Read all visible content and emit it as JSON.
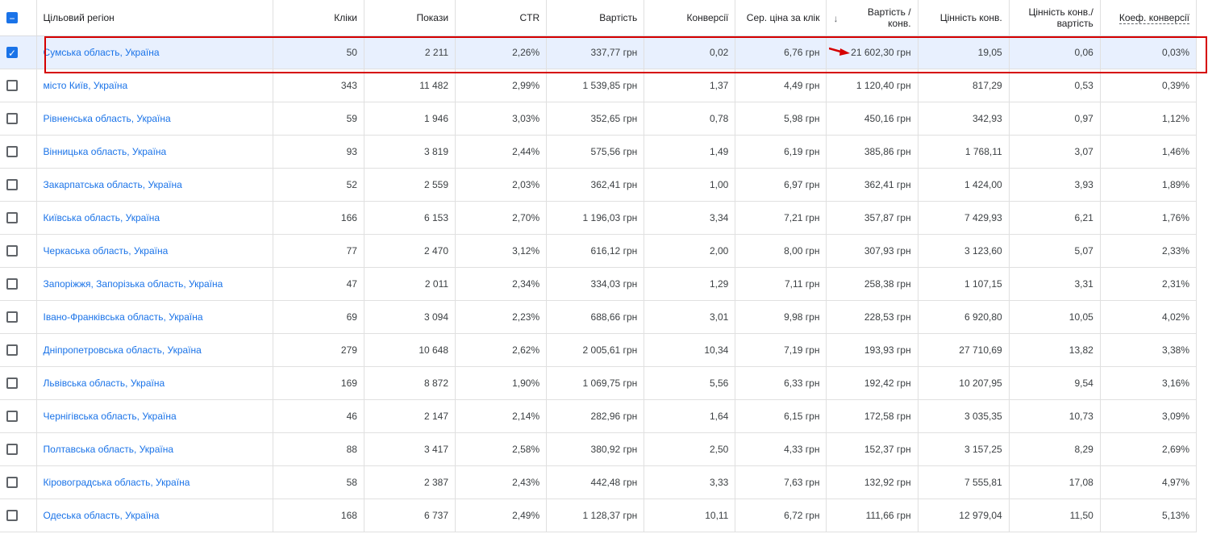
{
  "headers": {
    "region": "Цільовий регіон",
    "clicks": "Кліки",
    "impr": "Покази",
    "ctr": "CTR",
    "cost": "Вартість",
    "conv": "Конверсії",
    "cpc": "Сер. ціна за клік",
    "cpa1": "Вартість /",
    "cpa2": "конв.",
    "value": "Цінність конв.",
    "vpc1": "Цінність конв./",
    "vpc2": "вартість",
    "rate": "Коеф. конверсії"
  },
  "highlight_color": "#d50000",
  "rows": [
    [
      "Сумська область, Україна",
      "50",
      "2 211",
      "2,26%",
      "337,77 грн",
      "0,02",
      "6,76 грн",
      "21 602,30 грн",
      "19,05",
      "0,06",
      "0,03%"
    ],
    [
      "місто Київ, Україна",
      "343",
      "11 482",
      "2,99%",
      "1 539,85 грн",
      "1,37",
      "4,49 грн",
      "1 120,40 грн",
      "817,29",
      "0,53",
      "0,39%"
    ],
    [
      "Рівненська область, Україна",
      "59",
      "1 946",
      "3,03%",
      "352,65 грн",
      "0,78",
      "5,98 грн",
      "450,16 грн",
      "342,93",
      "0,97",
      "1,12%"
    ],
    [
      "Вінницька область, Україна",
      "93",
      "3 819",
      "2,44%",
      "575,56 грн",
      "1,49",
      "6,19 грн",
      "385,86 грн",
      "1 768,11",
      "3,07",
      "1,46%"
    ],
    [
      "Закарпатська область, Україна",
      "52",
      "2 559",
      "2,03%",
      "362,41 грн",
      "1,00",
      "6,97 грн",
      "362,41 грн",
      "1 424,00",
      "3,93",
      "1,89%"
    ],
    [
      "Київська область, Україна",
      "166",
      "6 153",
      "2,70%",
      "1 196,03 грн",
      "3,34",
      "7,21 грн",
      "357,87 грн",
      "7 429,93",
      "6,21",
      "1,76%"
    ],
    [
      "Черкаська область, Україна",
      "77",
      "2 470",
      "3,12%",
      "616,12 грн",
      "2,00",
      "8,00 грн",
      "307,93 грн",
      "3 123,60",
      "5,07",
      "2,33%"
    ],
    [
      "Запоріжжя, Запорізька область, Україна",
      "47",
      "2 011",
      "2,34%",
      "334,03 грн",
      "1,29",
      "7,11 грн",
      "258,38 грн",
      "1 107,15",
      "3,31",
      "2,31%"
    ],
    [
      "Івано-Франківська область, Україна",
      "69",
      "3 094",
      "2,23%",
      "688,66 грн",
      "3,01",
      "9,98 грн",
      "228,53 грн",
      "6 920,80",
      "10,05",
      "4,02%"
    ],
    [
      "Дніпропетровська область, Україна",
      "279",
      "10 648",
      "2,62%",
      "2 005,61 грн",
      "10,34",
      "7,19 грн",
      "193,93 грн",
      "27 710,69",
      "13,82",
      "3,38%"
    ],
    [
      "Львівська область, Україна",
      "169",
      "8 872",
      "1,90%",
      "1 069,75 грн",
      "5,56",
      "6,33 грн",
      "192,42 грн",
      "10 207,95",
      "9,54",
      "3,16%"
    ],
    [
      "Чернігівська область, Україна",
      "46",
      "2 147",
      "2,14%",
      "282,96 грн",
      "1,64",
      "6,15 грн",
      "172,58 грн",
      "3 035,35",
      "10,73",
      "3,09%"
    ],
    [
      "Полтавська область, Україна",
      "88",
      "3 417",
      "2,58%",
      "380,92 грн",
      "2,50",
      "4,33 грн",
      "152,37 грн",
      "3 157,25",
      "8,29",
      "2,69%"
    ],
    [
      "Кіровоградська область, Україна",
      "58",
      "2 387",
      "2,43%",
      "442,48 грн",
      "3,33",
      "7,63 грн",
      "132,92 грн",
      "7 555,81",
      "17,08",
      "4,97%"
    ],
    [
      "Одеська область, Україна",
      "168",
      "6 737",
      "2,49%",
      "1 128,37 грн",
      "10,11",
      "6,72 грн",
      "111,66 грн",
      "12 979,04",
      "11,50",
      "5,13%"
    ]
  ]
}
